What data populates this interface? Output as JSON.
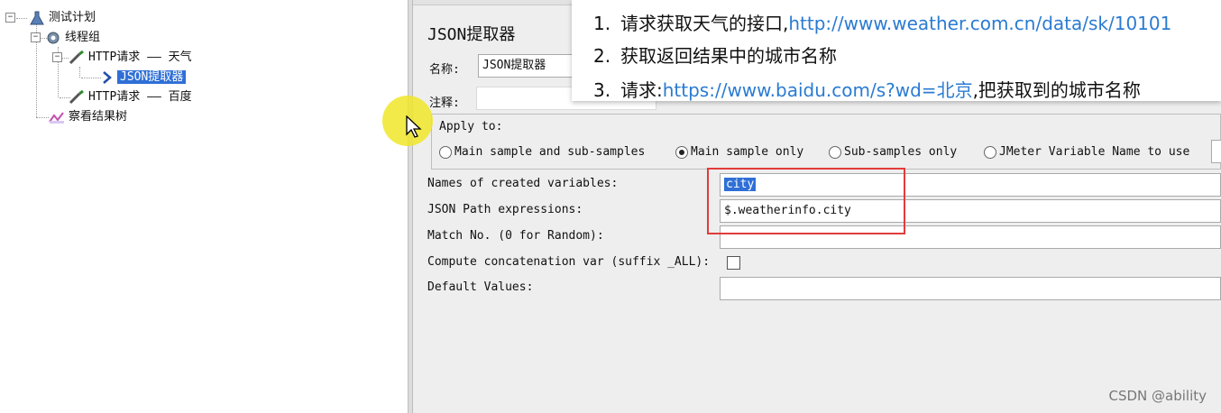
{
  "tree": {
    "items": [
      {
        "label": "测试计划"
      },
      {
        "label": "线程组"
      },
      {
        "label": "HTTP请求 —— 天气"
      },
      {
        "label": "JSON提取器"
      },
      {
        "label": "HTTP请求 —— 百度"
      },
      {
        "label": "察看结果树"
      }
    ]
  },
  "panel": {
    "title": "JSON提取器",
    "name_label": "名称:",
    "name_value": "JSON提取器",
    "comment_label": "注释:",
    "apply_to": {
      "label": "Apply to:",
      "options": [
        "Main sample and sub-samples",
        "Main sample only",
        "Sub-samples only",
        "JMeter Variable Name to use"
      ],
      "selected": "Main sample only"
    },
    "fields": {
      "names_label": "Names of created variables:",
      "names_value": "city",
      "path_label": "JSON Path expressions:",
      "path_value": "$.weatherinfo.city",
      "match_label": "Match No. (0 for Random):",
      "match_value": "",
      "concat_label": "Compute concatenation var (suffix _ALL):",
      "default_label": "Default Values:",
      "default_value": ""
    }
  },
  "note": {
    "lines": [
      {
        "num": "1.",
        "text": "请求获取天气的接口,",
        "link": "http://www.weather.com.cn/data/sk/10101"
      },
      {
        "num": "2.",
        "text": "获取返回结果中的城市名称",
        "link": ""
      },
      {
        "num": "3.",
        "text": "请求:",
        "link": "https://www.baidu.com/s?wd=北京",
        "after": ",把获取到的城市名称"
      }
    ]
  },
  "watermark": "CSDN @ability",
  "colors": {
    "selection": "#2f6fd6",
    "highlight_box": "#e23b3b",
    "link": "#2a7bd2",
    "cursor_halo": "#f0e628"
  }
}
